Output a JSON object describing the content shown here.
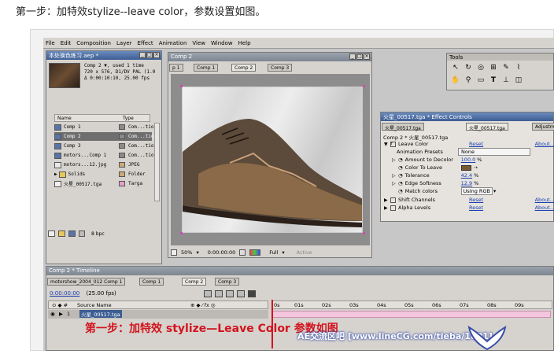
{
  "caption": "第一步：加特效stylize--leave color，参数设置如图。",
  "menu": [
    "File",
    "Edit",
    "Composition",
    "Layer",
    "Effect",
    "Animation",
    "View",
    "Window",
    "Help"
  ],
  "project": {
    "title": "本处换色练习.aep *",
    "info_lines": [
      "Comp 2 ▼, used 1 time",
      "720 x 576, D1/DV PAL (1.0",
      "Δ 0:00:10:10, 25.00 fps"
    ],
    "col_name": "Name",
    "col_type": "Type",
    "items": [
      {
        "name": "Comp 1",
        "type": "Com...tion"
      },
      {
        "name": "Comp 2",
        "type": "Com...tion"
      },
      {
        "name": "Comp 3",
        "type": "Com...tion"
      },
      {
        "name": "motors...Comp 1",
        "type": "Com...tion"
      },
      {
        "name": "motors...12.jpg",
        "type": "JPEG"
      },
      {
        "name": "Solids",
        "type": "Folder"
      },
      {
        "name": "火星_00517.tga",
        "type": "Targa"
      }
    ],
    "bpc": "8 bpc"
  },
  "comp": {
    "title": "Comp 2",
    "tabs": [
      "p 1",
      "Comp 1",
      "Comp 2",
      "Comp 3"
    ],
    "zoom": "50%",
    "timecode": "0:00:00:00",
    "resolution": "Full",
    "active_camera": "Active"
  },
  "tools": {
    "title": "Tools"
  },
  "effects": {
    "title": "火星_00517.tga * Effect Controls",
    "tabs": [
      "火星_00517.tga",
      "火星_00517.tga",
      "Adjustmen"
    ],
    "layer_path": "Comp 2 * 火星_00517.tga",
    "reset": "Reset",
    "about": "About...",
    "leave_color": "Leave Color",
    "animation_presets": "Animation Presets",
    "presets_value": "None",
    "amount_label": "Amount to Decolor",
    "amount_value": "100.0",
    "color_label": "Color To Leave",
    "color_swatch": "#7a5a33",
    "tolerance_label": "Tolerance",
    "tolerance_value": "42.4",
    "softness_label": "Edge Softness",
    "softness_value": "12.9",
    "match_label": "Match colors",
    "match_value": "Using RGB",
    "percent": "%",
    "shift_channels": "Shift Channels",
    "alpha_levels": "Alpha Levels"
  },
  "timeline": {
    "title": "Comp 2 * Timeline",
    "tabs": [
      "motorshow_2004_012 Comp 1",
      "Comp 1",
      "Comp 2",
      "Comp 3"
    ],
    "timecode": "0:00:00:00",
    "fps": "(25.00 fps)",
    "source_name_col": "Source Name",
    "layer_index": "1",
    "layer_name": "火星_00517.tga",
    "ruler": [
      "0s",
      "01s",
      "02s",
      "03s",
      "04s",
      "05s",
      "06s",
      "07s",
      "08s",
      "09s"
    ]
  },
  "overlay": {
    "step_text": "第一步：加特效 stylize—Leave Color  参数如图",
    "watermark": "AE交流区吧 [www.lineCG.com/tieba/1801]"
  },
  "colors": {
    "accent_red": "#d2141e",
    "title_blue": "#3d5e93",
    "pink_row": "#f3c6dd"
  }
}
